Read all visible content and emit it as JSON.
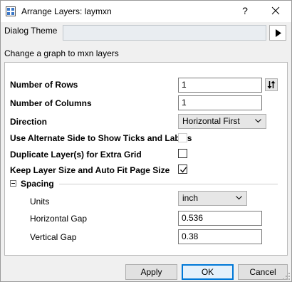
{
  "window": {
    "title": "Arrange Layers: laymxn",
    "help_label": "?"
  },
  "theme": {
    "label": "Dialog Theme",
    "value": ""
  },
  "description": "Change a graph to mxn layers",
  "form": {
    "rows": {
      "label": "Number of Rows",
      "value": "1"
    },
    "columns": {
      "label": "Number of Columns",
      "value": "1"
    },
    "direction": {
      "label": "Direction",
      "value": "Horizontal First"
    },
    "alternate_side": {
      "label": "Use Alternate Side to Show Ticks and Labels",
      "checked": false,
      "enabled": false
    },
    "duplicate": {
      "label": "Duplicate Layer(s) for Extra Grid",
      "checked": false
    },
    "keep_size": {
      "label": "Keep Layer Size and Auto Fit Page Size",
      "checked": true
    }
  },
  "spacing": {
    "title": "Spacing",
    "units": {
      "label": "Units",
      "value": "inch"
    },
    "hgap": {
      "label": "Horizontal Gap",
      "value": "0.536"
    },
    "vgap": {
      "label": "Vertical Gap",
      "value": "0.38"
    }
  },
  "buttons": {
    "apply": "Apply",
    "ok": "OK",
    "cancel": "Cancel"
  }
}
